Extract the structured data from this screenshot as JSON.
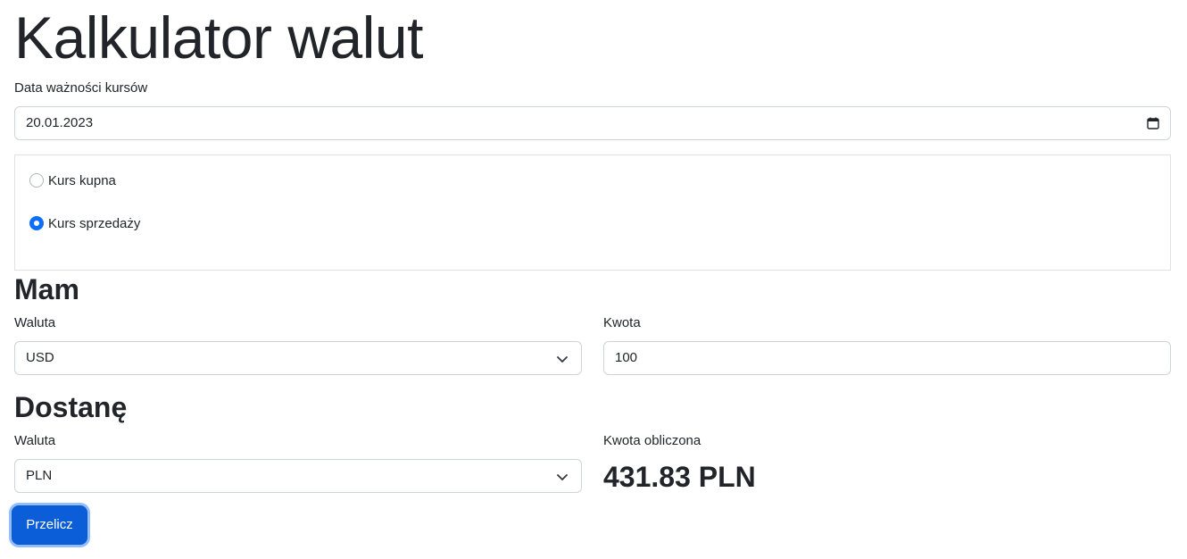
{
  "page_title": "Kalkulator walut",
  "rate_date": {
    "label": "Data ważności kursów",
    "value": "20.01.2023",
    "icon": "calendar-icon"
  },
  "rate_type": {
    "options": [
      {
        "label": "Kurs kupna",
        "checked": false
      },
      {
        "label": "Kurs sprzedaży",
        "checked": true
      }
    ]
  },
  "have": {
    "heading": "Mam",
    "currency_label": "Waluta",
    "currency_value": "USD",
    "amount_label": "Kwota",
    "amount_value": "100"
  },
  "get": {
    "heading": "Dostanę",
    "currency_label": "Waluta",
    "currency_value": "PLN",
    "computed_label": "Kwota obliczona",
    "computed_value": "431.83 PLN"
  },
  "actions": {
    "calculate_label": "Przelicz"
  },
  "colors": {
    "accent": "#0d6efd",
    "text": "#212529",
    "border": "#ced4da"
  }
}
